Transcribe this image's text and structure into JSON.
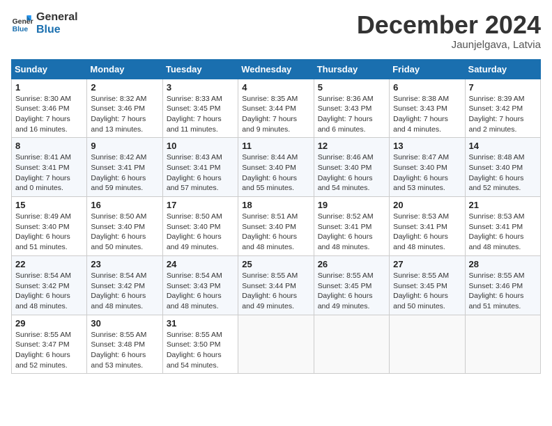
{
  "logo": {
    "line1": "General",
    "line2": "Blue"
  },
  "title": "December 2024",
  "location": "Jaunjelgava, Latvia",
  "weekdays": [
    "Sunday",
    "Monday",
    "Tuesday",
    "Wednesday",
    "Thursday",
    "Friday",
    "Saturday"
  ],
  "weeks": [
    [
      {
        "day": "1",
        "info": "Sunrise: 8:30 AM\nSunset: 3:46 PM\nDaylight: 7 hours\nand 16 minutes."
      },
      {
        "day": "2",
        "info": "Sunrise: 8:32 AM\nSunset: 3:46 PM\nDaylight: 7 hours\nand 13 minutes."
      },
      {
        "day": "3",
        "info": "Sunrise: 8:33 AM\nSunset: 3:45 PM\nDaylight: 7 hours\nand 11 minutes."
      },
      {
        "day": "4",
        "info": "Sunrise: 8:35 AM\nSunset: 3:44 PM\nDaylight: 7 hours\nand 9 minutes."
      },
      {
        "day": "5",
        "info": "Sunrise: 8:36 AM\nSunset: 3:43 PM\nDaylight: 7 hours\nand 6 minutes."
      },
      {
        "day": "6",
        "info": "Sunrise: 8:38 AM\nSunset: 3:43 PM\nDaylight: 7 hours\nand 4 minutes."
      },
      {
        "day": "7",
        "info": "Sunrise: 8:39 AM\nSunset: 3:42 PM\nDaylight: 7 hours\nand 2 minutes."
      }
    ],
    [
      {
        "day": "8",
        "info": "Sunrise: 8:41 AM\nSunset: 3:41 PM\nDaylight: 7 hours\nand 0 minutes."
      },
      {
        "day": "9",
        "info": "Sunrise: 8:42 AM\nSunset: 3:41 PM\nDaylight: 6 hours\nand 59 minutes."
      },
      {
        "day": "10",
        "info": "Sunrise: 8:43 AM\nSunset: 3:41 PM\nDaylight: 6 hours\nand 57 minutes."
      },
      {
        "day": "11",
        "info": "Sunrise: 8:44 AM\nSunset: 3:40 PM\nDaylight: 6 hours\nand 55 minutes."
      },
      {
        "day": "12",
        "info": "Sunrise: 8:46 AM\nSunset: 3:40 PM\nDaylight: 6 hours\nand 54 minutes."
      },
      {
        "day": "13",
        "info": "Sunrise: 8:47 AM\nSunset: 3:40 PM\nDaylight: 6 hours\nand 53 minutes."
      },
      {
        "day": "14",
        "info": "Sunrise: 8:48 AM\nSunset: 3:40 PM\nDaylight: 6 hours\nand 52 minutes."
      }
    ],
    [
      {
        "day": "15",
        "info": "Sunrise: 8:49 AM\nSunset: 3:40 PM\nDaylight: 6 hours\nand 51 minutes."
      },
      {
        "day": "16",
        "info": "Sunrise: 8:50 AM\nSunset: 3:40 PM\nDaylight: 6 hours\nand 50 minutes."
      },
      {
        "day": "17",
        "info": "Sunrise: 8:50 AM\nSunset: 3:40 PM\nDaylight: 6 hours\nand 49 minutes."
      },
      {
        "day": "18",
        "info": "Sunrise: 8:51 AM\nSunset: 3:40 PM\nDaylight: 6 hours\nand 48 minutes."
      },
      {
        "day": "19",
        "info": "Sunrise: 8:52 AM\nSunset: 3:41 PM\nDaylight: 6 hours\nand 48 minutes."
      },
      {
        "day": "20",
        "info": "Sunrise: 8:53 AM\nSunset: 3:41 PM\nDaylight: 6 hours\nand 48 minutes."
      },
      {
        "day": "21",
        "info": "Sunrise: 8:53 AM\nSunset: 3:41 PM\nDaylight: 6 hours\nand 48 minutes."
      }
    ],
    [
      {
        "day": "22",
        "info": "Sunrise: 8:54 AM\nSunset: 3:42 PM\nDaylight: 6 hours\nand 48 minutes."
      },
      {
        "day": "23",
        "info": "Sunrise: 8:54 AM\nSunset: 3:42 PM\nDaylight: 6 hours\nand 48 minutes."
      },
      {
        "day": "24",
        "info": "Sunrise: 8:54 AM\nSunset: 3:43 PM\nDaylight: 6 hours\nand 48 minutes."
      },
      {
        "day": "25",
        "info": "Sunrise: 8:55 AM\nSunset: 3:44 PM\nDaylight: 6 hours\nand 49 minutes."
      },
      {
        "day": "26",
        "info": "Sunrise: 8:55 AM\nSunset: 3:45 PM\nDaylight: 6 hours\nand 49 minutes."
      },
      {
        "day": "27",
        "info": "Sunrise: 8:55 AM\nSunset: 3:45 PM\nDaylight: 6 hours\nand 50 minutes."
      },
      {
        "day": "28",
        "info": "Sunrise: 8:55 AM\nSunset: 3:46 PM\nDaylight: 6 hours\nand 51 minutes."
      }
    ],
    [
      {
        "day": "29",
        "info": "Sunrise: 8:55 AM\nSunset: 3:47 PM\nDaylight: 6 hours\nand 52 minutes."
      },
      {
        "day": "30",
        "info": "Sunrise: 8:55 AM\nSunset: 3:48 PM\nDaylight: 6 hours\nand 53 minutes."
      },
      {
        "day": "31",
        "info": "Sunrise: 8:55 AM\nSunset: 3:50 PM\nDaylight: 6 hours\nand 54 minutes."
      },
      null,
      null,
      null,
      null
    ]
  ]
}
